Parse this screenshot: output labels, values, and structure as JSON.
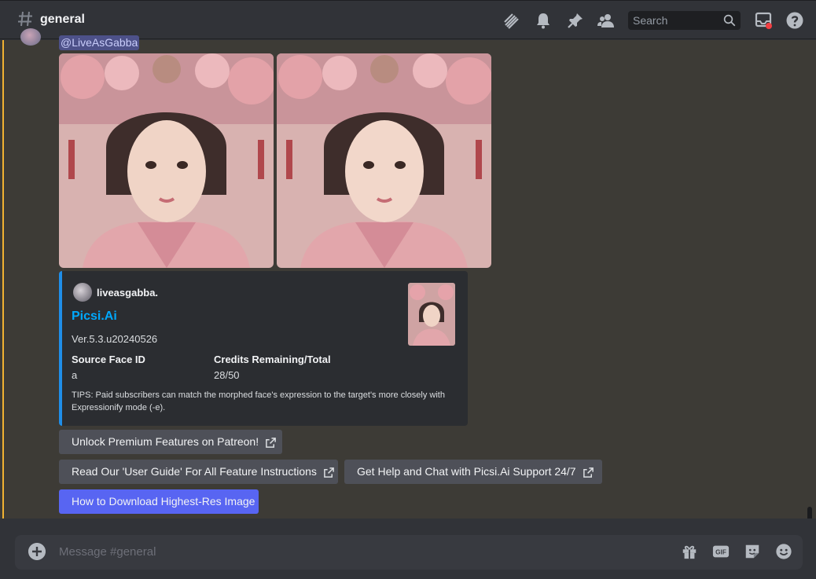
{
  "header": {
    "channel": "general",
    "search_placeholder": "Search"
  },
  "message": {
    "mention": "@LiveAsGabba"
  },
  "embed": {
    "author": "liveasgabba.",
    "title": "Picsi.Ai",
    "description": "Ver.5.3.u20240526",
    "fields": [
      {
        "name": "Source Face ID",
        "value": "a"
      },
      {
        "name": "Credits Remaining/Total",
        "value": "28/50"
      }
    ],
    "tips": "TIPS: Paid subscribers can match the morphed face's expression to the target's more closely with Expressionify mode (-e)."
  },
  "buttons": [
    {
      "label": "Unlock Premium Features on Patreon!",
      "external": true
    },
    {
      "label": "Read Our 'User Guide' For All Feature Instructions",
      "external": true
    },
    {
      "label": "Get Help and Chat with Picsi.Ai Support 24/7",
      "external": true
    },
    {
      "label": "How to Download Highest-Res Image",
      "external": false
    }
  ],
  "composer": {
    "placeholder": "Message #general"
  },
  "colors": {
    "accent": "#5865f2",
    "link": "#00a8fc",
    "embed_border": "#1f8ee9",
    "highlight_bar": "#f0b232"
  }
}
